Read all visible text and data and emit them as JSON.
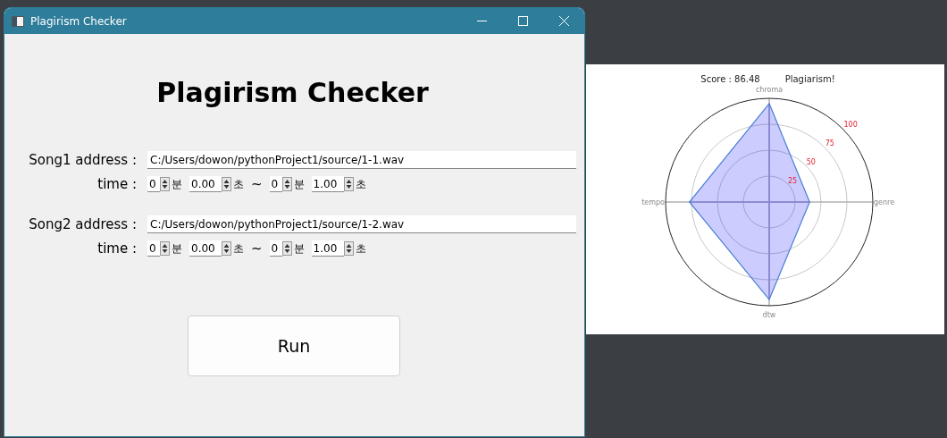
{
  "window": {
    "title": "Plagirism Checker"
  },
  "heading": "Plagirism Checker",
  "songs": [
    {
      "label": "Song1 address :",
      "path": "C:/Users/dowon/pythonProject1/source/1-1.wav",
      "time_label": "time :",
      "start": [
        {
          "value": "0",
          "unit": "분"
        },
        {
          "value": "0.00",
          "unit": "초"
        }
      ],
      "separator": "~",
      "end": [
        {
          "value": "0",
          "unit": "분"
        },
        {
          "value": "1.00",
          "unit": "초"
        }
      ]
    },
    {
      "label": "Song2 address :",
      "path": "C:/Users/dowon/pythonProject1/source/1-2.wav",
      "time_label": "time :",
      "start": [
        {
          "value": "0",
          "unit": "분"
        },
        {
          "value": "0.00",
          "unit": "초"
        }
      ],
      "separator": "~",
      "end": [
        {
          "value": "0",
          "unit": "분"
        },
        {
          "value": "1.00",
          "unit": "초"
        }
      ]
    }
  ],
  "run_button": "Run",
  "result": {
    "score": "Score : 86.48",
    "verdict": "Plagiarism!",
    "radar_axes": [
      {
        "label": "chroma",
        "level": 0.95
      },
      {
        "label": "genre",
        "level": 0.39
      },
      {
        "label": "dtw",
        "level": 0.94
      },
      {
        "label": "tempo",
        "level": 0.77
      }
    ],
    "ring_labels": [
      "25",
      "50",
      "75",
      "100"
    ]
  }
}
